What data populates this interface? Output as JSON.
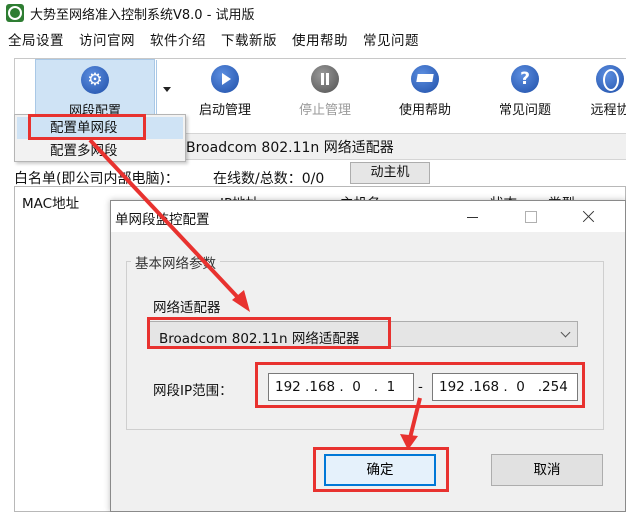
{
  "window": {
    "title": "大势至网络准入控制系统V8.0 - 试用版"
  },
  "menubar": {
    "items": [
      "全局设置",
      "访问官网",
      "软件介绍",
      "下载新版",
      "使用帮助",
      "常见问题"
    ]
  },
  "toolbar": {
    "net_config": "网段配置",
    "start": "启动管理",
    "stop": "停止管理",
    "help": "使用帮助",
    "faq": "常见问题",
    "remote": "远程协"
  },
  "dropdown": {
    "single": "配置单网段",
    "multi": "配置多网段"
  },
  "main": {
    "adapter_text": "Broadcom 802.11n 网络适配器",
    "whitelist_label": "白名单(即公司内部电脑)：",
    "online_label": "在线数/总数：0/0",
    "host_button": "动主机",
    "columns": {
      "mac": "MAC地址",
      "ip": "IP地址",
      "host": "主机名",
      "status": "状态",
      "type": "类型"
    }
  },
  "dialog": {
    "title": "单网段监控配置",
    "group_title": "基本网络参数",
    "adapter_label": "网络适配器",
    "adapter_value": "Broadcom 802.11n 网络适配器",
    "ip_range_label": "网段IP范围：",
    "ip_start": "192 .168 .  0   .  1",
    "ip_end": "192 .168 .  0   .254",
    "dash": "-",
    "ok": "确定",
    "cancel": "取消"
  },
  "colors": {
    "annotation_red": "#e8322f",
    "highlight_blue": "#cfe3f5",
    "focus_blue": "#0078d7"
  }
}
